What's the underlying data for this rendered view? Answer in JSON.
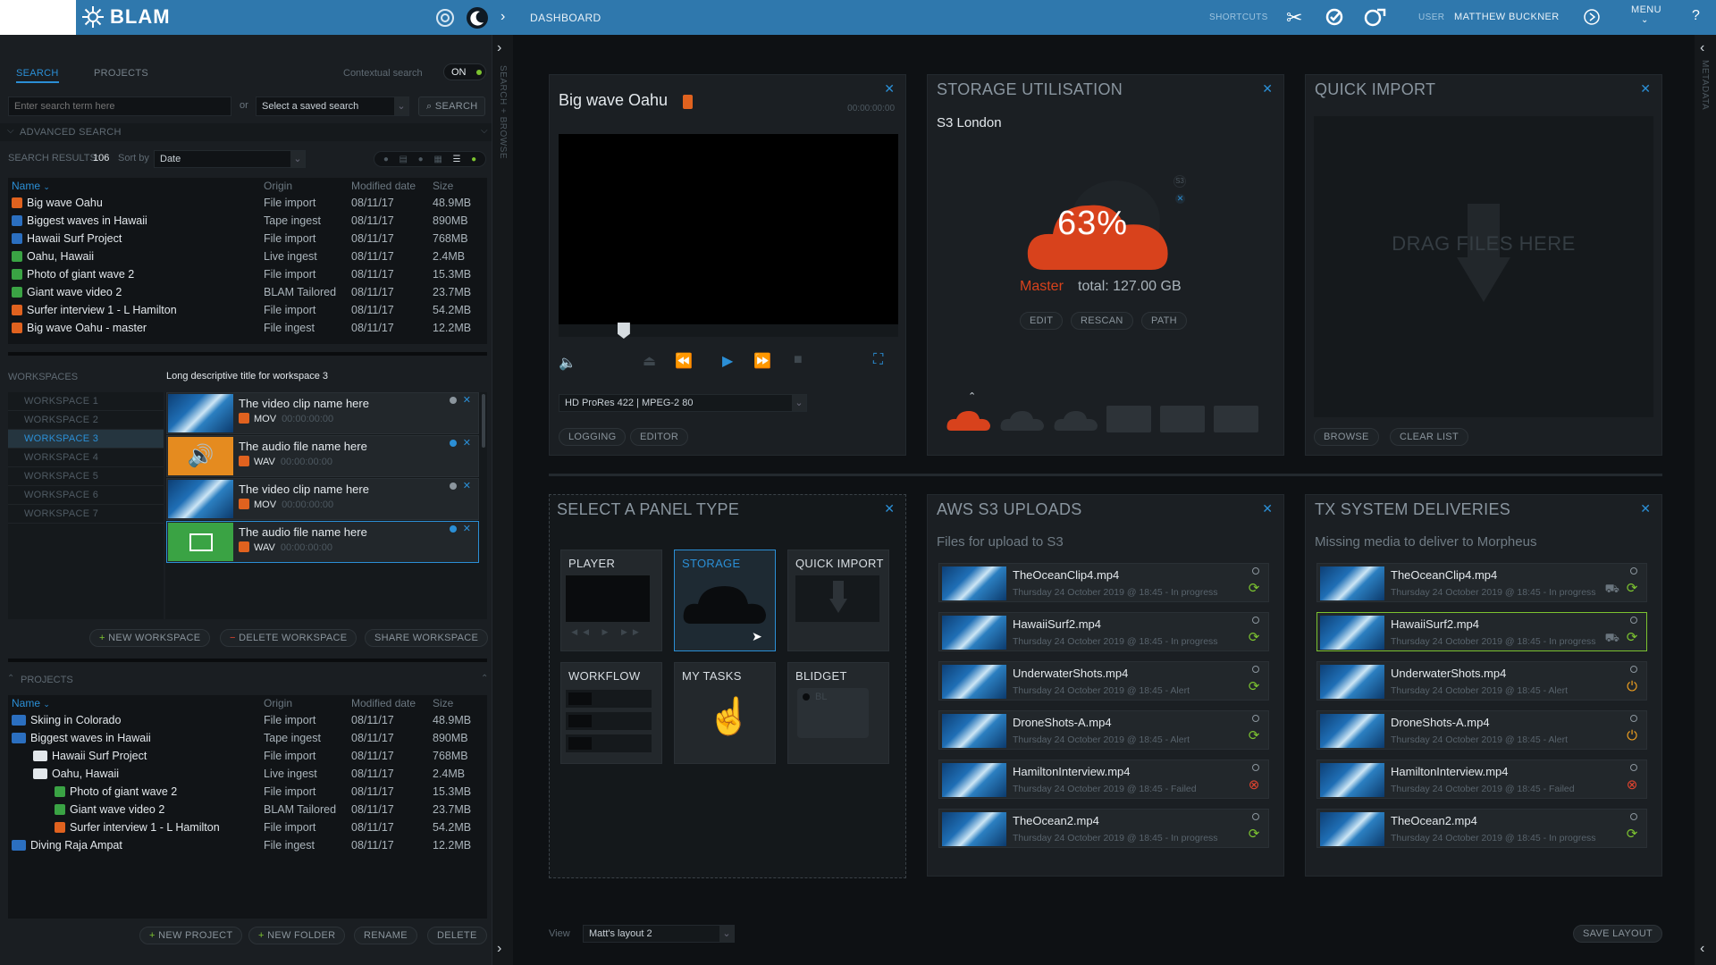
{
  "topbar": {
    "app_name": "BLAM",
    "page": "DASHBOARD",
    "shortcuts_label": "SHORTCUTS",
    "user_label": "USER",
    "user_name": "MATTHEW BUCKNER",
    "menu_label": "MENU",
    "help_label": "?"
  },
  "search": {
    "tab_search": "SEARCH",
    "tab_projects": "PROJECTS",
    "contextual_label": "Contextual search",
    "contextual_value": "ON",
    "input_placeholder": "Enter search term here",
    "or_label": "or",
    "saved_search_placeholder": "Select a saved search",
    "search_button": "SEARCH",
    "advanced_label": "ADVANCED SEARCH",
    "results_label": "SEARCH RESULTS:",
    "results_count": "106",
    "sort_label": "Sort by",
    "sort_value": "Date",
    "columns": [
      "Name",
      "Origin",
      "Modified date",
      "Size"
    ],
    "rows": [
      {
        "name": "Big wave Oahu",
        "origin": "File import",
        "date": "08/11/17",
        "size": "48.9MB",
        "icon": "video-file-icon",
        "color": "#e0621f"
      },
      {
        "name": "Biggest waves in Hawaii",
        "origin": "Tape ingest",
        "date": "08/11/17",
        "size": "890MB",
        "icon": "tape-file-icon",
        "color": "#2b6fc0"
      },
      {
        "name": "Hawaii Surf Project",
        "origin": "File import",
        "date": "08/11/17",
        "size": "768MB",
        "icon": "document-file-icon",
        "color": "#2b6fc0"
      },
      {
        "name": "Oahu, Hawaii",
        "origin": "Live ingest",
        "date": "08/11/17",
        "size": "2.4MB",
        "icon": "live-file-icon",
        "color": "#3aa344"
      },
      {
        "name": "Photo of giant wave 2",
        "origin": "File import",
        "date": "08/11/17",
        "size": "15.3MB",
        "icon": "image-file-icon",
        "color": "#3aa344"
      },
      {
        "name": "Giant wave video 2",
        "origin": "BLAM Tailored",
        "date": "08/11/17",
        "size": "23.7MB",
        "icon": "video-file-icon",
        "color": "#3aa344"
      },
      {
        "name": "Surfer interview 1 - L Hamilton",
        "origin": "File import",
        "date": "08/11/17",
        "size": "54.2MB",
        "icon": "audio-file-icon",
        "color": "#e0621f"
      },
      {
        "name": "Big wave Oahu - master",
        "origin": "File ingest",
        "date": "08/11/17",
        "size": "12.2MB",
        "icon": "video-file-icon",
        "color": "#e0621f"
      }
    ]
  },
  "workspaces": {
    "label": "WORKSPACES",
    "title": "Long descriptive title for workspace 3",
    "items": [
      "WORKSPACE 1",
      "WORKSPACE 2",
      "WORKSPACE 3",
      "WORKSPACE 4",
      "WORKSPACE 5",
      "WORKSPACE 6",
      "WORKSPACE 7"
    ],
    "active_index": 2,
    "clips": [
      {
        "name": "The video clip name here",
        "format": "MOV",
        "tc": "00:00:00:00",
        "type": "video"
      },
      {
        "name": "The audio file name here",
        "format": "WAV",
        "tc": "00:00:00:00",
        "type": "audio"
      },
      {
        "name": "The video clip name here",
        "format": "MOV",
        "tc": "00:00:00:00",
        "type": "video"
      },
      {
        "name": "The audio file name here",
        "format": "WAV",
        "tc": "00:00:00:00",
        "type": "image"
      }
    ],
    "new_button": "NEW WORKSPACE",
    "delete_button": "DELETE WORKSPACE",
    "share_button": "SHARE WORKSPACE"
  },
  "projects": {
    "label": "PROJECTS",
    "columns": [
      "Name",
      "Origin",
      "Modified date",
      "Size"
    ],
    "rows": [
      {
        "name": "Skiing in Colorado",
        "origin": "File import",
        "date": "08/11/17",
        "size": "48.9MB",
        "indent": 0,
        "icon": "project-icon"
      },
      {
        "name": "Biggest waves in Hawaii",
        "origin": "Tape ingest",
        "date": "08/11/17",
        "size": "890MB",
        "indent": 0,
        "icon": "project-icon"
      },
      {
        "name": "Hawaii Surf Project",
        "origin": "File import",
        "date": "08/11/17",
        "size": "768MB",
        "indent": 1,
        "icon": "folder-icon"
      },
      {
        "name": "Oahu, Hawaii",
        "origin": "Live ingest",
        "date": "08/11/17",
        "size": "2.4MB",
        "indent": 1,
        "icon": "folder-icon"
      },
      {
        "name": "Photo of giant wave 2",
        "origin": "File import",
        "date": "08/11/17",
        "size": "15.3MB",
        "indent": 2,
        "icon": "image-file-icon"
      },
      {
        "name": "Giant wave video 2",
        "origin": "BLAM Tailored",
        "date": "08/11/17",
        "size": "23.7MB",
        "indent": 2,
        "icon": "video-file-icon"
      },
      {
        "name": "Surfer interview 1 - L Hamilton",
        "origin": "File import",
        "date": "08/11/17",
        "size": "54.2MB",
        "indent": 2,
        "icon": "audio-file-icon"
      },
      {
        "name": "Diving Raja Ampat",
        "origin": "File ingest",
        "date": "08/11/17",
        "size": "12.2MB",
        "indent": 0,
        "icon": "project-icon"
      }
    ],
    "new_project": "NEW PROJECT",
    "new_folder": "NEW FOLDER",
    "rename": "RENAME",
    "delete": "DELETE"
  },
  "side_labels": {
    "search_browse": "SEARCH + BROWSE",
    "metadata": "METADATA"
  },
  "player": {
    "title": "Big wave Oahu",
    "timecode": "00:00:00:00",
    "format": "HD ProRes 422 | MPEG-2 80",
    "logging_button": "LOGGING",
    "editor_button": "EDITOR",
    "scrub_fraction": 0.18
  },
  "storage": {
    "title": "STORAGE UTILISATION",
    "location": "S3 London",
    "percent": "63%",
    "badge": "S3",
    "master_label": "Master",
    "total": "total: 127.00 GB",
    "edit": "EDIT",
    "rescan": "RESCAN",
    "path": "PATH"
  },
  "quick_import": {
    "title": "QUICK IMPORT",
    "drop_text": "DRAG FILES HERE",
    "browse": "BROWSE",
    "clear": "CLEAR LIST"
  },
  "select_panel": {
    "title": "SELECT A PANEL TYPE",
    "tiles": [
      "PLAYER",
      "STORAGE",
      "QUICK IMPORT",
      "WORKFLOW",
      "MY TASKS",
      "BLIDGET"
    ],
    "bl_label": "BL"
  },
  "aws": {
    "title": "AWS S3 UPLOADS",
    "subtitle": "Files for upload  to S3",
    "rows": [
      {
        "name": "TheOceanClip4.mp4",
        "status": "Thursday 24 October 2019 @ 18:45 - In progress",
        "state": "progress"
      },
      {
        "name": "HawaiiSurf2.mp4",
        "status": "Thursday 24 October 2019 @ 18:45 - In progress",
        "state": "progress"
      },
      {
        "name": "UnderwaterShots.mp4",
        "status": "Thursday 24 October 2019 @ 18:45 - Alert",
        "state": "progress"
      },
      {
        "name": "DroneShots-A.mp4",
        "status": "Thursday 24 October 2019 @ 18:45 - Alert",
        "state": "progress"
      },
      {
        "name": "HamiltonInterview.mp4",
        "status": "Thursday 24 October 2019 @ 18:45 - Failed",
        "state": "failed"
      },
      {
        "name": "TheOcean2.mp4",
        "status": "Thursday 24 October 2019 @ 18:45 - In progress",
        "state": "progress"
      }
    ]
  },
  "tx": {
    "title": "TX SYSTEM DELIVERIES",
    "subtitle": "Missing media to deliver to Morpheus",
    "rows": [
      {
        "name": "TheOceanClip4.mp4",
        "status": "Thursday 24 October 2019 @ 18:45 - In progress",
        "state": "progress"
      },
      {
        "name": "HawaiiSurf2.mp4",
        "status": "Thursday 24 October 2019 @ 18:45 - In progress",
        "state": "progress"
      },
      {
        "name": "UnderwaterShots.mp4",
        "status": "Thursday 24 October 2019 @ 18:45 - Alert",
        "state": "alert"
      },
      {
        "name": "DroneShots-A.mp4",
        "status": "Thursday 24 October 2019 @ 18:45 - Alert",
        "state": "alert"
      },
      {
        "name": "HamiltonInterview.mp4",
        "status": "Thursday 24 October 2019 @ 18:45 - Failed",
        "state": "failed"
      },
      {
        "name": "TheOcean2.mp4",
        "status": "Thursday 24 October 2019 @ 18:45 - In progress",
        "state": "progress"
      }
    ]
  },
  "footer": {
    "view_label": "View",
    "view_value": "Matt's layout 2",
    "save_layout": "SAVE LAYOUT"
  },
  "colors": {
    "accent": "#2b8fd6",
    "topbar": "#2f78ad",
    "storage_cloud": "#d8421c",
    "ok": "#7cc330",
    "failed": "#e2442f",
    "alert": "#f0a020"
  }
}
